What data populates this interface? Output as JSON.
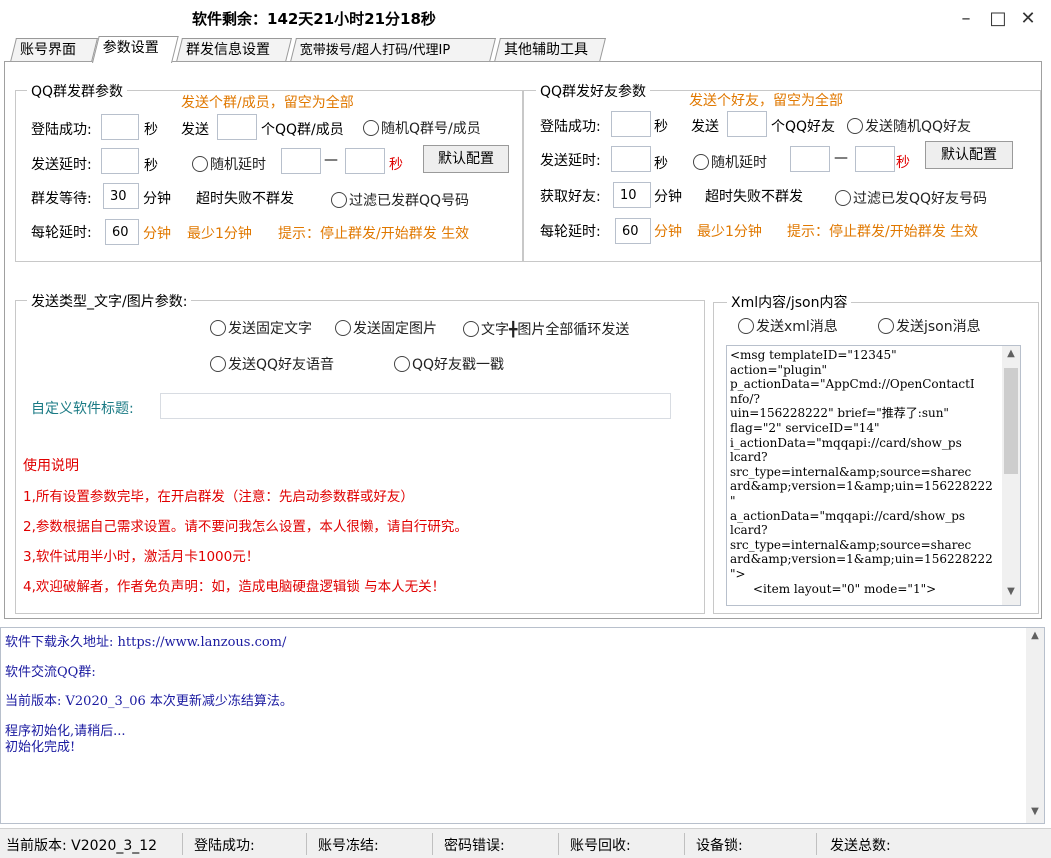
{
  "window": {
    "title": "软件剩余：142天21小时21分18秒",
    "minimize": "–",
    "maximize": "□",
    "close": "✕"
  },
  "tabs": [
    {
      "label": "账号界面"
    },
    {
      "label": "参数设置"
    },
    {
      "label": "群发信息设置"
    },
    {
      "label": "宽带拨号/超人打码/代理IP"
    },
    {
      "label": "其他辅助工具"
    }
  ],
  "group_params": {
    "title": "QQ群发群参数",
    "hint": "发送个群/成员，留空为全部",
    "login_label": "登陆成功:",
    "login_value": "",
    "sec1": "秒",
    "send_label": "发送",
    "send_value": "",
    "send_unit": "个QQ群/成员",
    "random_group": "随机Q群号/成员",
    "delay_label": "发送延时:",
    "delay_value": "",
    "sec2": "秒",
    "random_delay": "随机延时",
    "rand_from": "",
    "dash": "—",
    "rand_to": "",
    "sec_red": "秒",
    "default_btn": "默认配置",
    "wait_label": "群发等待:",
    "wait_value": "30",
    "min1": "分钟",
    "timeout_text": "超时失败不群发",
    "filter_text": "过滤已发群QQ号码",
    "round_label": "每轮延时:",
    "round_value": "60",
    "min2": "分钟",
    "min_note": "最少1分钟",
    "tip": "提示：停止群发/开始群发 生效"
  },
  "friend_params": {
    "title": "QQ群发好友参数",
    "hint": "发送个好友，留空为全部",
    "login_label": "登陆成功:",
    "login_value": "",
    "sec1": "秒",
    "send_label": "发送",
    "send_value": "",
    "send_unit": "个QQ好友",
    "random_friend": "发送随机QQ好友",
    "delay_label": "发送延时:",
    "delay_value": "",
    "sec2": "秒",
    "random_delay": "随机延时",
    "rand_from": "",
    "dash": "—",
    "rand_to": "",
    "sec_red": "秒",
    "default_btn": "默认配置",
    "get_label": "获取好友:",
    "get_value": "10",
    "min1": "分钟",
    "timeout_text": "超时失败不群发",
    "filter_text": "过滤已发QQ好友号码",
    "round_label": "每轮延时:",
    "round_value": "60",
    "min2": "分钟",
    "min_note": "最少1分钟",
    "tip": "提示：停止群发/开始群发 生效"
  },
  "send_type": {
    "title": "发送类型_文字/图片参数:",
    "opt_text": "发送固定文字",
    "opt_image": "发送固定图片",
    "opt_cycle": "文字╋图片全部循环发送",
    "opt_voice": "发送QQ好友语音",
    "opt_poke": "QQ好友戳一戳",
    "custom_title_label": "自定义软件标题:",
    "custom_title_value": "",
    "usage_title": "使用说明",
    "usage": [
      "1,所有设置参数完毕，在开启群发（注意：先启动参数群或好友）",
      "2,参数根据自己需求设置。请不要问我怎么设置，本人很懒，请自行研究。",
      "3,软件试用半小时，激活月卡1000元！",
      "4,欢迎破解者，作者免负声明：如，造成电脑硬盘逻辑锁 与本人无关！"
    ]
  },
  "xml_group": {
    "title": "Xml内容/json内容",
    "opt_xml": "发送xml消息",
    "opt_json": "发送json消息",
    "content": "<msg templateID=\"12345\"\naction=\"plugin\"\np_actionData=\"AppCmd://OpenContactI\nnfo/?\nuin=156228222\" brief=\"推荐了:sun\"\nflag=\"2\" serviceID=\"14\"\ni_actionData=\"mqqapi://card/show_ps\nlcard?\nsrc_type=internal&amp;source=sharec\nard&amp;version=1&amp;uin=156228222\n\"\na_actionData=\"mqqapi://card/show_ps\nlcard?\nsrc_type=internal&amp;source=sharec\nard&amp;version=1&amp;uin=156228222\n\">\n      <item layout=\"0\" mode=\"1\">"
  },
  "log": [
    "软件下载永久地址: https://www.lanzous.com/",
    "软件交流QQ群:",
    "当前版本: V2020_3_06  本次更新减少冻结算法。",
    "程序初始化,请稍后...",
    "初始化完成!"
  ],
  "statusbar": {
    "version": "当前版本: V2020_3_12",
    "login": "登陆成功:",
    "frozen": "账号冻结:",
    "pwd_error": "密码错误:",
    "recycle": "账号回收:",
    "device_lock": "设备锁:",
    "total": "发送总数:"
  },
  "colors": {
    "accent_orange": "#e07800",
    "warning_red": "#e00000",
    "label_teal": "#1a7a84",
    "log_blue": "#1a1aa0"
  }
}
